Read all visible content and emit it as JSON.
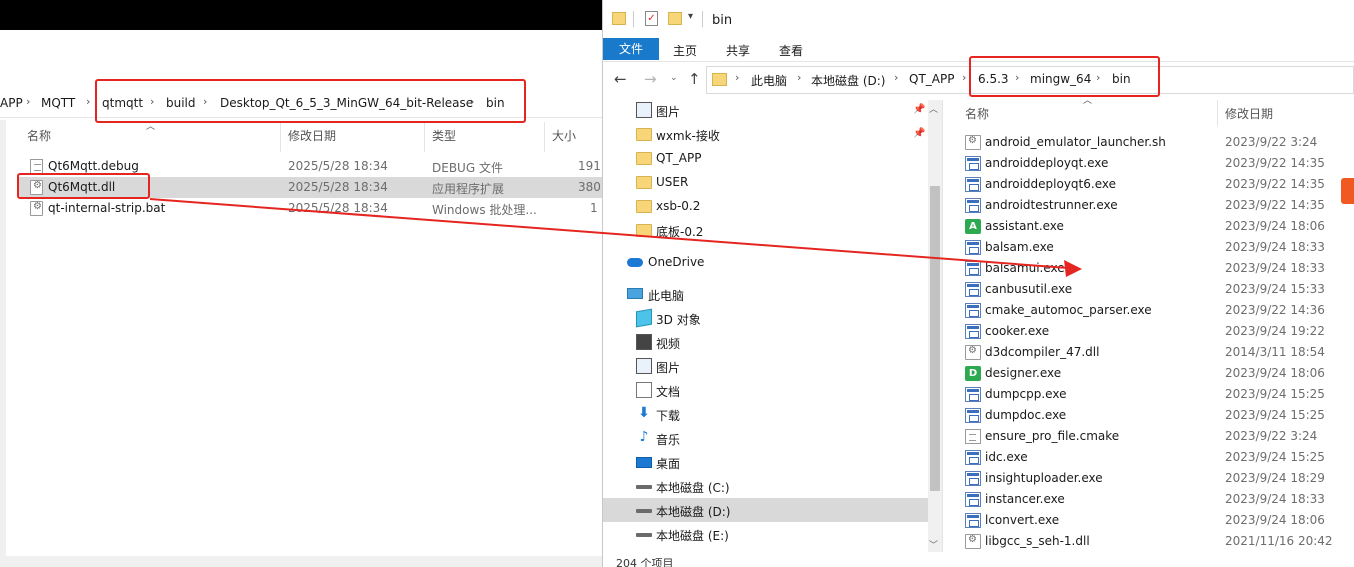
{
  "left_window": {
    "breadcrumb": [
      "APP",
      "MQTT",
      "qtmqtt",
      "build",
      "Desktop_Qt_6_5_3_MinGW_64_bit-Release",
      "bin"
    ],
    "columns": {
      "name": "名称",
      "date": "修改日期",
      "type": "类型",
      "size": "大小"
    },
    "files": [
      {
        "name": "Qt6Mqtt.debug",
        "date": "2025/5/28 18:34",
        "type": "DEBUG 文件",
        "size": "191",
        "icon": "text-file-icon"
      },
      {
        "name": "Qt6Mqtt.dll",
        "date": "2025/5/28 18:34",
        "type": "应用程序扩展",
        "size": "380",
        "icon": "dll-icon",
        "selected": true
      },
      {
        "name": "qt-internal-strip.bat",
        "date": "2025/5/28 18:34",
        "type": "Windows 批处理...",
        "size": "1",
        "icon": "batch-file-icon"
      }
    ]
  },
  "right_window": {
    "title": "bin",
    "ribbon_tabs": [
      "文件",
      "主页",
      "共享",
      "查看"
    ],
    "breadcrumb": [
      "此电脑",
      "本地磁盘 (D:)",
      "QT_APP",
      "6.5.3",
      "mingw_64",
      "bin"
    ],
    "columns": {
      "name": "名称",
      "date": "修改日期"
    },
    "nav_tree": [
      {
        "label": "图片",
        "icon": "pictures-icon",
        "pinned": true
      },
      {
        "label": "wxmk-接收",
        "icon": "folder-icon",
        "pinned": true
      },
      {
        "label": "QT_APP",
        "icon": "folder-icon"
      },
      {
        "label": "USER",
        "icon": "folder-icon"
      },
      {
        "label": "xsb-0.2",
        "icon": "folder-icon"
      },
      {
        "label": "底板-0.2",
        "icon": "folder-icon"
      },
      {
        "label": "OneDrive",
        "icon": "onedrive-icon"
      },
      {
        "label": "此电脑",
        "icon": "this-pc-icon"
      },
      {
        "label": "3D 对象",
        "icon": "3d-objects-icon"
      },
      {
        "label": "视频",
        "icon": "videos-icon"
      },
      {
        "label": "图片",
        "icon": "pictures-icon"
      },
      {
        "label": "文档",
        "icon": "documents-icon"
      },
      {
        "label": "下载",
        "icon": "downloads-icon"
      },
      {
        "label": "音乐",
        "icon": "music-icon"
      },
      {
        "label": "桌面",
        "icon": "desktop-icon"
      },
      {
        "label": "本地磁盘 (C:)",
        "icon": "drive-icon"
      },
      {
        "label": "本地磁盘 (D:)",
        "icon": "drive-icon",
        "selected": true
      },
      {
        "label": "本地磁盘 (E:)",
        "icon": "drive-icon"
      }
    ],
    "files": [
      {
        "name": "android_emulator_launcher.sh",
        "date": "2023/9/22 3:24",
        "icon": "script-icon"
      },
      {
        "name": "androiddeployqt.exe",
        "date": "2023/9/22 14:35",
        "icon": "exe-icon"
      },
      {
        "name": "androiddeployqt6.exe",
        "date": "2023/9/22 14:35",
        "icon": "exe-icon"
      },
      {
        "name": "androidtestrunner.exe",
        "date": "2023/9/22 14:35",
        "icon": "exe-icon"
      },
      {
        "name": "assistant.exe",
        "date": "2023/9/24 18:06",
        "icon": "assistant-app-icon"
      },
      {
        "name": "balsam.exe",
        "date": "2023/9/24 18:33",
        "icon": "exe-icon"
      },
      {
        "name": "balsamui.exe",
        "date": "2023/9/24 18:33",
        "icon": "exe-icon"
      },
      {
        "name": "canbusutil.exe",
        "date": "2023/9/24 15:33",
        "icon": "exe-icon"
      },
      {
        "name": "cmake_automoc_parser.exe",
        "date": "2023/9/22 14:36",
        "icon": "exe-icon"
      },
      {
        "name": "cooker.exe",
        "date": "2023/9/24 19:22",
        "icon": "exe-icon"
      },
      {
        "name": "d3dcompiler_47.dll",
        "date": "2014/3/11 18:54",
        "icon": "dll-icon"
      },
      {
        "name": "designer.exe",
        "date": "2023/9/24 18:06",
        "icon": "designer-app-icon"
      },
      {
        "name": "dumpcpp.exe",
        "date": "2023/9/24 15:25",
        "icon": "exe-icon"
      },
      {
        "name": "dumpdoc.exe",
        "date": "2023/9/24 15:25",
        "icon": "exe-icon"
      },
      {
        "name": "ensure_pro_file.cmake",
        "date": "2023/9/22 3:24",
        "icon": "text-file-icon"
      },
      {
        "name": "idc.exe",
        "date": "2023/9/24 15:25",
        "icon": "exe-icon"
      },
      {
        "name": "insightuploader.exe",
        "date": "2023/9/24 18:29",
        "icon": "exe-icon"
      },
      {
        "name": "instancer.exe",
        "date": "2023/9/24 18:33",
        "icon": "exe-icon"
      },
      {
        "name": "lconvert.exe",
        "date": "2023/9/24 18:06",
        "icon": "exe-icon"
      },
      {
        "name": "libgcc_s_seh-1.dll",
        "date": "2021/11/16 20:42",
        "icon": "dll-icon"
      }
    ],
    "status": "204 个项目"
  },
  "colors": {
    "annotation_red": "#e52620",
    "file_tab_blue": "#1979ca",
    "selection_gray": "#d9d9d9"
  }
}
